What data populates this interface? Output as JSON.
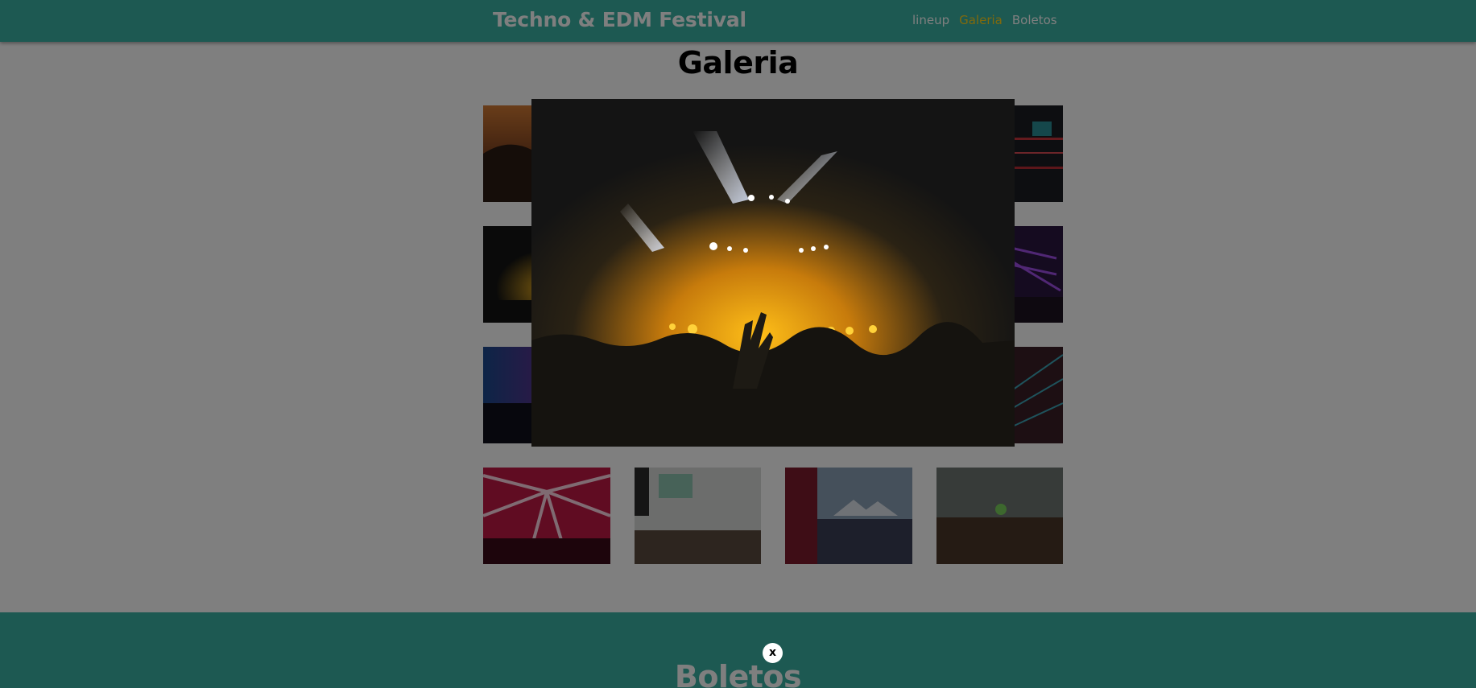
{
  "header": {
    "title": "Techno & EDM Festival",
    "nav": [
      "lineup",
      "Galeria",
      "Boletos"
    ],
    "active_nav": "Galeria",
    "accent_color": "#3bb3a5",
    "active_color": "#ffd21a"
  },
  "gallery": {
    "title": "Galeria",
    "images": [
      "concert-crowd-orange-photo",
      "concert-stage-red-lights-photo",
      "concert-stage-yellow-lights-photo",
      "concert-purple-stage-photo",
      "concert-blue-stage-photo",
      "concert-laser-crowd-photo",
      "concert-red-lasers-photo",
      "festival-crowd-screen-photo",
      "dj-festival-tents-photo",
      "festival-crowd-smoke-photo"
    ]
  },
  "modal": {
    "image": "concert-crowd-stage-lights-photo",
    "close_label": "x"
  },
  "tickets": {
    "title": "Boletos"
  }
}
